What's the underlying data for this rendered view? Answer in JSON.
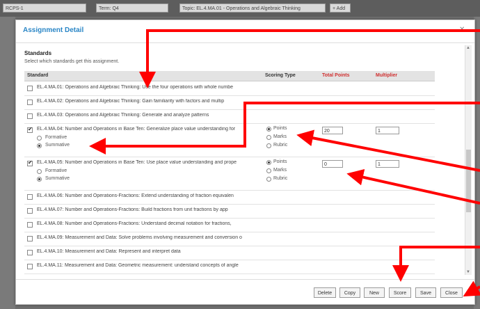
{
  "top_bar": {
    "selects": [
      {
        "value": "RCPS-1"
      },
      {
        "value": "Term: Q4"
      },
      {
        "value": "Topic: EL.4.MA.01 - Operations and Algebraic Thinking"
      }
    ],
    "add_label": "+ Add"
  },
  "modal": {
    "title": "Assignment Detail",
    "section_title": "Standards",
    "section_help": "Select which standards get this assignment.",
    "columns": {
      "standard": "Standard",
      "scoring_type": "Scoring Type",
      "total_points": "Total Points",
      "multiplier": "Multiplier"
    },
    "scoring_options": [
      "Points",
      "Marks",
      "Rubric"
    ],
    "type_options": [
      "Formative",
      "Summative"
    ],
    "rows": [
      {
        "label": "EL.4.MA.01: Operations and Algebraic Thinking: Use the four operations with whole numbe",
        "checked": false
      },
      {
        "label": "EL.4.MA.02: Operations and Algebraic Thinking: Gain familiarity with factors and multip",
        "checked": false
      },
      {
        "label": "EL.4.MA.03: Operations and Algebraic Thinking: Generate and analyze patterns",
        "checked": false
      },
      {
        "label": "EL.4.MA.04: Number and Operations in Base Ten: Generalize place value understanding for",
        "checked": true,
        "total_points": "20",
        "multiplier": "1",
        "scoring": "Points",
        "type": "Summative"
      },
      {
        "label": "EL.4.MA.05: Number and Operations in Base Ten: Use place value understanding and prope",
        "checked": true,
        "total_points": "0",
        "multiplier": "1",
        "scoring": "Points",
        "type": "Summative"
      },
      {
        "label": "EL.4.MA.06: Number and Operations-Fractions: Extend understanding of fraction equivalen",
        "checked": false
      },
      {
        "label": "EL.4.MA.07: Number and Operations-Fractions: Build fractions from unit fractions by app",
        "checked": false
      },
      {
        "label": "EL.4.MA.08: Number and Operations-Fractions: Understand decimal notation for fractions,",
        "checked": false
      },
      {
        "label": "EL.4.MA.09: Measurement and Data: Solve problems involving measurement and conversion o",
        "checked": false
      },
      {
        "label": "EL.4.MA.10: Measurement and Data: Represent and interpret data",
        "checked": false
      },
      {
        "label": "EL.4.MA.11: Measurement and Data: Geometric measurement: understand concepts of angle",
        "checked": false
      }
    ],
    "buttons": {
      "delete": "Delete",
      "copy": "Copy",
      "new": "New",
      "score": "Score",
      "save": "Save",
      "close": "Close"
    }
  },
  "colors": {
    "title_blue": "#2a86c6",
    "required_red": "#d03030",
    "annotation_red": "#ff0000"
  }
}
